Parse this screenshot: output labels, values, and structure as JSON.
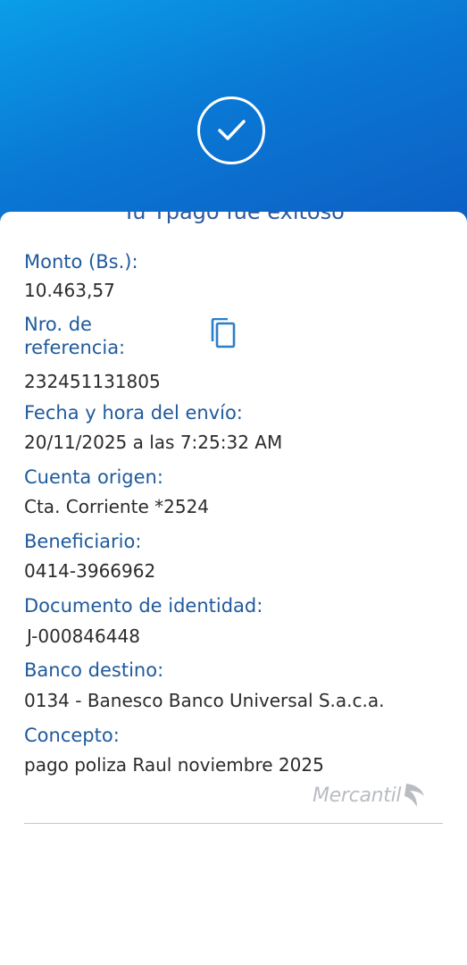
{
  "receipt": {
    "headline": "Tu Tpago fue exitoso",
    "fields": [
      {
        "label": "Monto (Bs.):",
        "value": "10.463,57"
      },
      {
        "label": "Nro. de\nreferencia:",
        "value": "232451131805"
      },
      {
        "label": "Fecha y hora del envío:",
        "value": "20/11/2025 a las 7:25:32 AM"
      },
      {
        "label": "Cuenta origen:",
        "value": "Cta. Corriente *2524"
      },
      {
        "label": "Beneficiario:",
        "value": "0414-3966962"
      },
      {
        "label": "Documento de identidad:",
        "value": "J-000846448"
      },
      {
        "label": "Banco destino:",
        "value": "0134 - Banesco Banco Universal S.a.c.a."
      },
      {
        "label": "Concepto:",
        "value": "pago poliza Raul noviembre 2025"
      }
    ],
    "brand": "Mercantil"
  },
  "icons": {
    "status": "check-circle-icon",
    "copy": "copy-icon",
    "brand": "mercantil-logo-icon"
  },
  "colors": {
    "header_start": "#0a9ee8",
    "header_end": "#0d5cc2",
    "label": "#1f5a9c",
    "value": "#2b2b2b",
    "brand": "#b9bcc2"
  }
}
